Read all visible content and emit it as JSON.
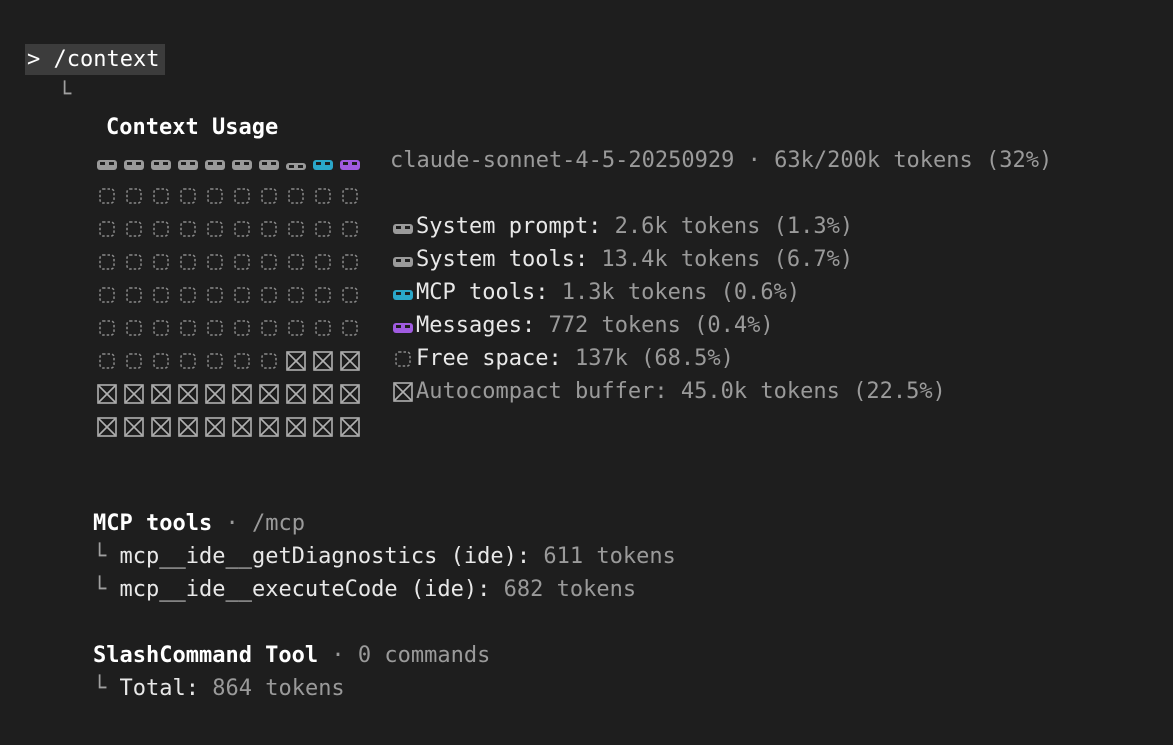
{
  "command": {
    "text": "> /context"
  },
  "tree_corner": "└",
  "context_usage": {
    "title": "Context Usage",
    "summary": "claude-sonnet-4-5-20250929 · 63k/200k tokens (32%)",
    "grid": {
      "rows": [
        [
          "system-prompt",
          "system-tools",
          "system-tools",
          "system-tools",
          "system-tools",
          "system-tools",
          "system-tools",
          "system-tools-partial",
          "mcp-tools",
          "messages"
        ],
        [
          "free",
          "free",
          "free",
          "free",
          "free",
          "free",
          "free",
          "free",
          "free",
          "free"
        ],
        [
          "free",
          "free",
          "free",
          "free",
          "free",
          "free",
          "free",
          "free",
          "free",
          "free"
        ],
        [
          "free",
          "free",
          "free",
          "free",
          "free",
          "free",
          "free",
          "free",
          "free",
          "free"
        ],
        [
          "free",
          "free",
          "free",
          "free",
          "free",
          "free",
          "free",
          "free",
          "free",
          "free"
        ],
        [
          "free",
          "free",
          "free",
          "free",
          "free",
          "free",
          "free",
          "free",
          "free",
          "free"
        ],
        [
          "free",
          "free",
          "free",
          "free",
          "free",
          "free",
          "free",
          "buffer",
          "buffer",
          "buffer"
        ],
        [
          "buffer",
          "buffer",
          "buffer",
          "buffer",
          "buffer",
          "buffer",
          "buffer",
          "buffer",
          "buffer",
          "buffer"
        ],
        [
          "buffer",
          "buffer",
          "buffer",
          "buffer",
          "buffer",
          "buffer",
          "buffer",
          "buffer",
          "buffer",
          "buffer"
        ]
      ]
    },
    "legend": [
      {
        "icon": "system-icon",
        "label": "System prompt:",
        "value": " 2.6k tokens (1.3%)",
        "color": "#9a9a9a"
      },
      {
        "icon": "system-icon",
        "label": "System tools:",
        "value": " 13.4k tokens (6.7%)",
        "color": "#9a9a9a"
      },
      {
        "icon": "mcp-icon",
        "label": "MCP tools:",
        "value": " 1.3k tokens (0.6%)",
        "color": "#2aa7c9"
      },
      {
        "icon": "messages-icon",
        "label": "Messages:",
        "value": " 772 tokens (0.4%)",
        "color": "#a05be0"
      },
      {
        "icon": "free-icon",
        "label": "Free space:",
        "value": " 137k (68.5%)",
        "color": "#8a8a8a"
      },
      {
        "icon": "buffer-icon",
        "label": "Autocompact buffer: 45.0k tokens (22.5%)",
        "value": "",
        "color": "#b0b0b0"
      }
    ]
  },
  "mcp_section": {
    "title": "MCP tools",
    "sep": " · ",
    "subtitle": "/mcp",
    "items": [
      {
        "name": "mcp__ide__getDiagnostics (ide):",
        "value": " 611 tokens"
      },
      {
        "name": "mcp__ide__executeCode (ide):",
        "value": " 682 tokens"
      }
    ]
  },
  "slash_section": {
    "title": "SlashCommand Tool",
    "sep": " · ",
    "subtitle": "0 commands",
    "total_label": "Total:",
    "total_value": " 864 tokens"
  },
  "colors": {
    "background": "#1e1e1e",
    "system": "#9a9a9a",
    "mcp": "#2aa7c9",
    "messages": "#a05be0",
    "free": "#8a8a8a",
    "buffer": "#b0b0b0"
  }
}
